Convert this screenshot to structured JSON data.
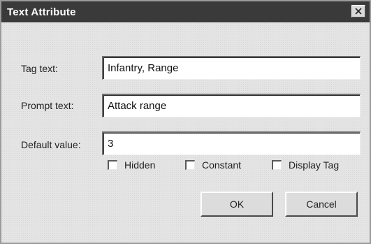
{
  "window": {
    "title": "Text Attribute",
    "close_icon": "close-icon"
  },
  "fields": {
    "tag": {
      "label": "Tag text:",
      "value": "Infantry, Range"
    },
    "prompt": {
      "label": "Prompt text:",
      "value": "Attack range"
    },
    "default": {
      "label": "Default value:",
      "value": "3"
    }
  },
  "options": {
    "hidden": {
      "label": "Hidden",
      "checked": false
    },
    "constant": {
      "label": "Constant",
      "checked": false
    },
    "display_tag": {
      "label": "Display Tag",
      "checked": false
    }
  },
  "buttons": {
    "ok": "OK",
    "cancel": "Cancel"
  }
}
